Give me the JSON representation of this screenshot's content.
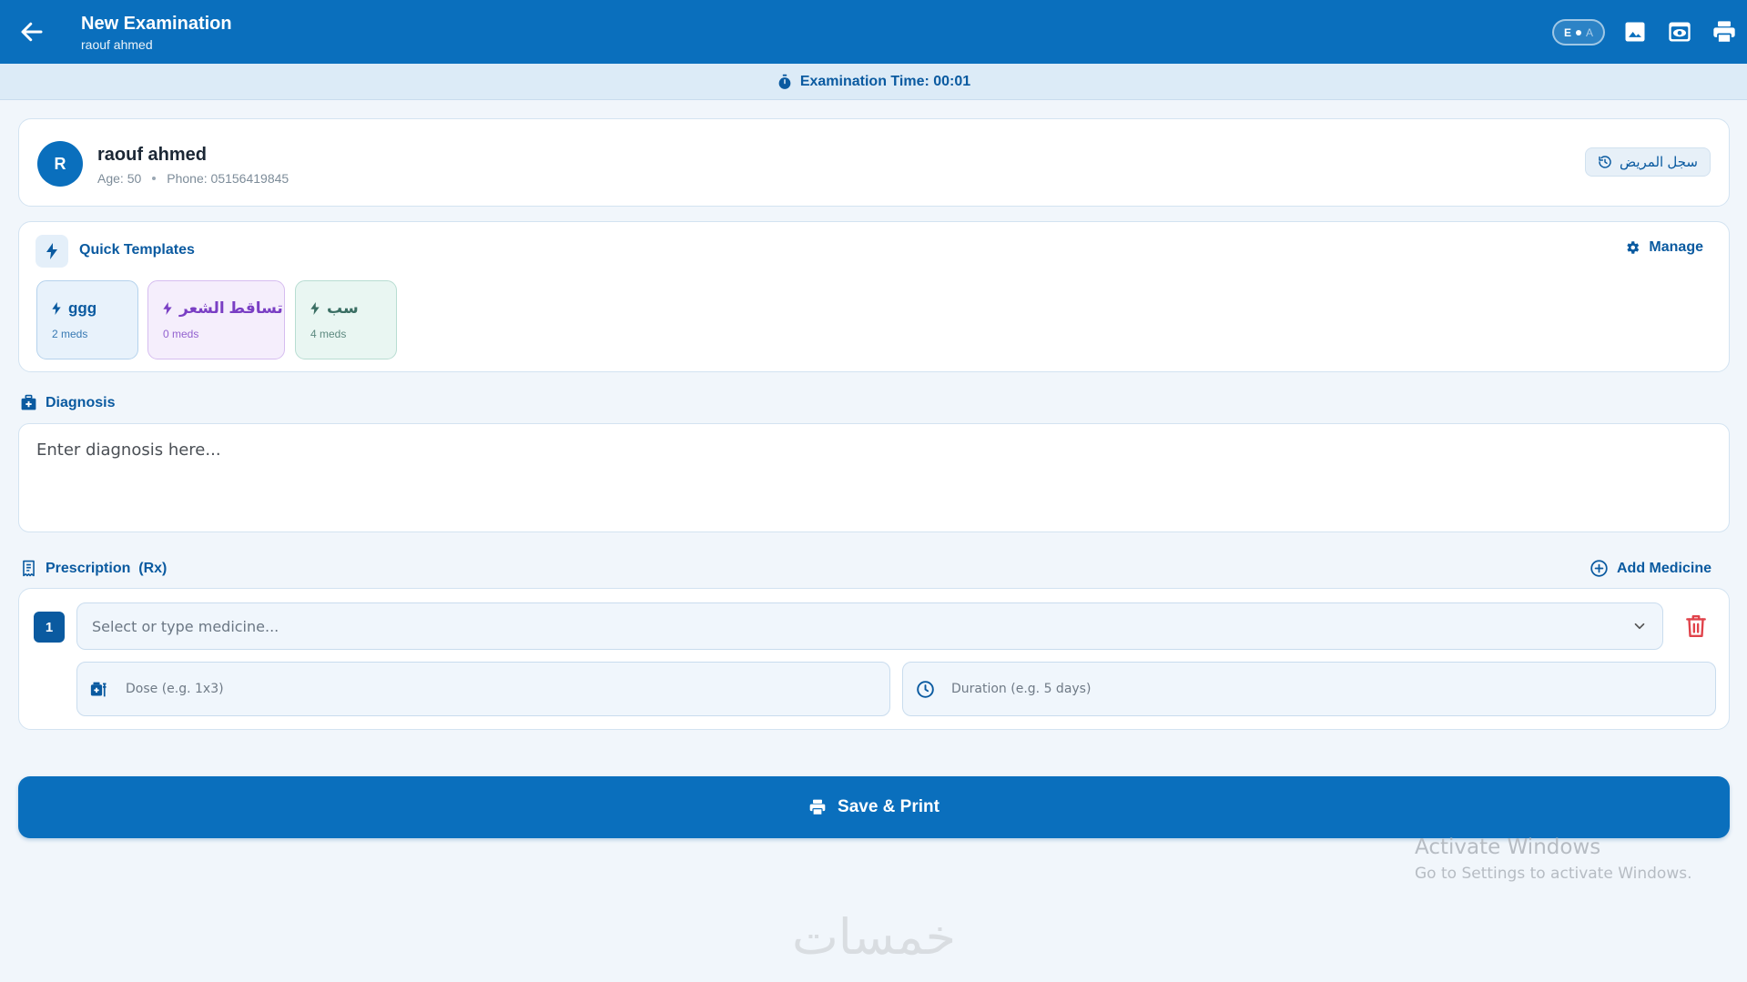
{
  "header": {
    "title": "New Examination",
    "subtitle": "raouf ahmed",
    "lang_active": "E",
    "lang_inactive": "A",
    "icons": [
      "back-arrow-icon",
      "image-icon",
      "preview-icon",
      "print-icon"
    ]
  },
  "timer": {
    "label": "Examination Time: 00:01"
  },
  "patient": {
    "avatar_letter": "R",
    "name": "raouf ahmed",
    "age": "Age: 50",
    "phone": "Phone: 05156419845",
    "history_label": "سجل المريض"
  },
  "templates": {
    "title": "Quick Templates",
    "manage_label": "Manage",
    "items": [
      {
        "name": "ggg",
        "meds": "2 meds",
        "color": "#0a5aa0"
      },
      {
        "name": "تساقط الشعر",
        "meds": "0 meds",
        "color": "#7a3fc4"
      },
      {
        "name": "سب",
        "meds": "4 meds",
        "color": "#3a6e63"
      }
    ]
  },
  "diagnosis": {
    "label": "Diagnosis",
    "placeholder": "Enter diagnosis here..."
  },
  "prescription": {
    "label": "Prescription  (Rx)",
    "add_label": "Add Medicine",
    "rows": [
      {
        "number": "1",
        "medicine_placeholder": "Select or type medicine...",
        "dose_placeholder": "Dose (e.g. 1x3)",
        "duration_placeholder": "Duration (e.g. 5 days)"
      }
    ]
  },
  "save_label": "Save & Print",
  "windows_watermark": {
    "title": "Activate Windows",
    "subtitle": "Go to Settings to activate Windows."
  },
  "brand_logo": "خمسات",
  "colors": {
    "primary": "#0a6fbd",
    "primary_dark": "#0a5aa0",
    "danger": "#e0424a",
    "background": "#f1f6fb"
  }
}
